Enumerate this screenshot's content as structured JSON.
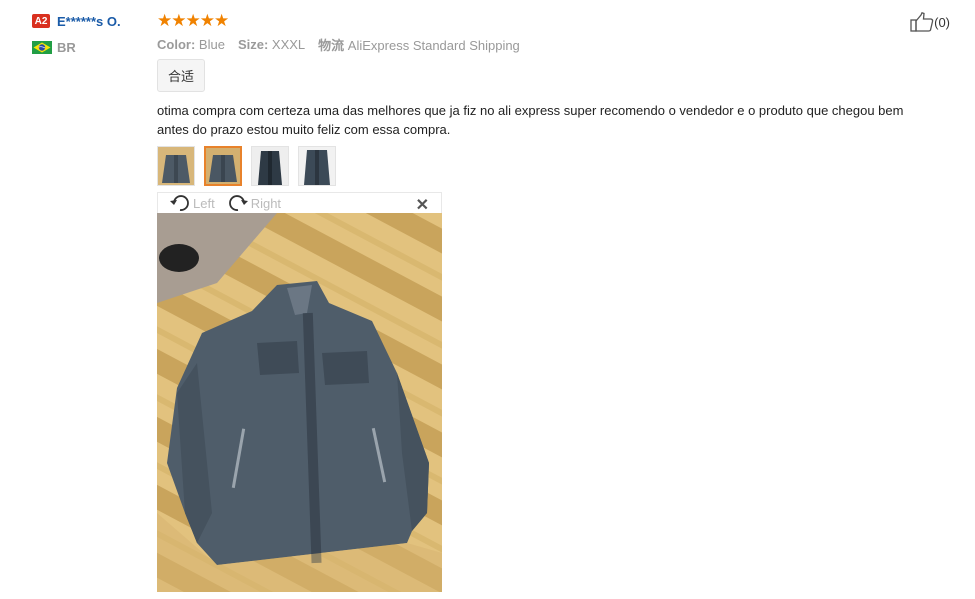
{
  "reviewer": {
    "level_badge": "A2",
    "name": "E******s O.",
    "country_code": "BR",
    "flag_icon": "brazil-flag-icon"
  },
  "review": {
    "rating": 5,
    "rating_max": 5,
    "attributes": [
      {
        "label": "Color:",
        "value": "Blue"
      },
      {
        "label": "Size:",
        "value": "XXXL"
      },
      {
        "label": "物流",
        "value": "AliExpress Standard Shipping"
      }
    ],
    "tag": "合适",
    "text": "otima compra com certeza uma das melhores que ja fiz no ali express super recomendo o vendedor e o produto que chegou bem antes do prazo estou muito feliz com essa compra.",
    "thumbnails": 4,
    "active_thumbnail": 2
  },
  "viewer": {
    "left_label": "Left",
    "right_label": "Right",
    "close_icon": "close-icon"
  },
  "like": {
    "count_label": "(0)",
    "icon": "thumbs-up-icon"
  },
  "colors": {
    "star": "#f08200",
    "username": "#1a5ba8",
    "badge": "#d9301f",
    "active_border": "#e8822b"
  }
}
